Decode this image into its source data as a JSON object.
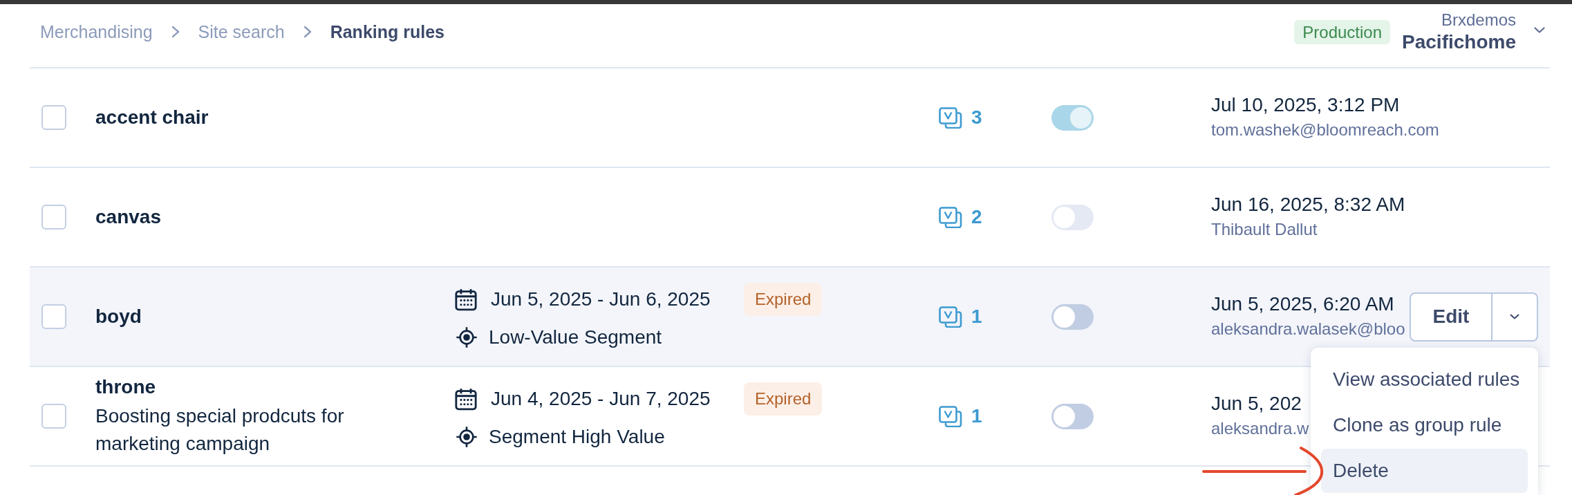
{
  "breadcrumb": [
    {
      "label": "Merchandising",
      "current": false
    },
    {
      "label": "Site search",
      "current": false
    },
    {
      "label": "Ranking rules",
      "current": true
    }
  ],
  "environment": {
    "label": "Production"
  },
  "account": {
    "organization": "Brxdemos",
    "name": "Pacifichome"
  },
  "rules": [
    {
      "checked": false,
      "name": "accent chair",
      "rule_count": "3",
      "on": true,
      "disabled": false,
      "updated": "Jul 10, 2025, 3:12 PM",
      "author": "tom.washek@bloomreach.com",
      "hovered": false
    },
    {
      "checked": false,
      "name": "canvas",
      "rule_count": "2",
      "on": false,
      "disabled": false,
      "updated": "Jun 16, 2025, 8:32 AM",
      "author": "Thibault Dallut",
      "hovered": false
    },
    {
      "checked": false,
      "name": "boyd",
      "schedule": {
        "dates": "Jun 5, 2025 - Jun 6, 2025",
        "segment": "Low-Value Segment"
      },
      "status": "Expired",
      "rule_count": "1",
      "on": false,
      "disabled": true,
      "updated": "Jun 5, 2025, 6:20 AM",
      "author": "aleksandra.walasek@bloo",
      "hovered": true,
      "actions": {
        "edit": "Edit",
        "menu": [
          {
            "label": "View associated rules",
            "highlighted": false
          },
          {
            "label": "Clone as group rule",
            "highlighted": false
          },
          {
            "label": "Delete",
            "highlighted": true
          }
        ]
      }
    },
    {
      "checked": false,
      "name": "throne",
      "description": "Boosting special prodcuts for marketing campaign",
      "schedule": {
        "dates": "Jun 4, 2025 - Jun 7, 2025",
        "segment": "Segment High Value"
      },
      "status": "Expired",
      "rule_count": "1",
      "on": false,
      "disabled": true,
      "updated": "Jun 5, 202",
      "author": "aleksandra.w",
      "hovered": false
    }
  ]
}
